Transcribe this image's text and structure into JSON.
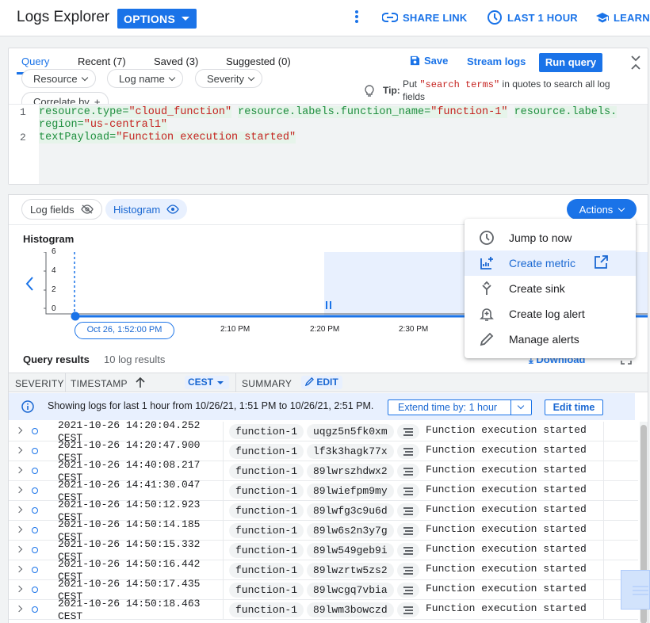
{
  "header": {
    "title": "Logs Explorer",
    "options_label": "OPTIONS",
    "share_label": "SHARE LINK",
    "time_label": "LAST 1 HOUR",
    "learn_label": "LEARN"
  },
  "query": {
    "tabs": [
      {
        "label": "Query"
      },
      {
        "label": "Recent (7)"
      },
      {
        "label": "Saved (3)"
      },
      {
        "label": "Suggested (0)"
      }
    ],
    "save_label": "Save",
    "stream_label": "Stream logs",
    "run_label": "Run query",
    "filters": [
      {
        "label": "Resource"
      },
      {
        "label": "Log name"
      },
      {
        "label": "Severity"
      }
    ],
    "correlate_label": "Correlate by",
    "tip_label": "Tip:",
    "tip_pre": "Put ",
    "tip_code": "\"search terms\"",
    "tip_post": " in quotes to search all log fields",
    "line_numbers": [
      "1",
      "2"
    ],
    "code": {
      "l1_key1": "resource.type",
      "l1_val1": "\"cloud_function\"",
      "l1_key2": "resource.labels.function_name",
      "l1_val2": "\"function-1\"",
      "l1_key3": "resource.labels.",
      "l1b_key3": "region",
      "l1b_val3": "\"us-central1\"",
      "l2_key": "textPayload",
      "l2_val": "\"Function execution started\""
    }
  },
  "results": {
    "log_fields_label": "Log fields",
    "histogram_label": "Histogram",
    "actions_label": "Actions",
    "histogram_title": "Histogram",
    "y_ticks": [
      "6",
      "4",
      "2",
      "0"
    ],
    "x_ticks": [
      "2:10 PM",
      "2:20 PM",
      "2:30 PM"
    ],
    "time_chip": "Oct 26, 1:52:00 PM",
    "query_results_title": "Query results",
    "log_count": "10 log results",
    "download_label": "Download",
    "columns": {
      "severity": "SEVERITY",
      "timestamp": "TIMESTAMP",
      "timezone": "CEST",
      "summary": "SUMMARY",
      "edit": "EDIT"
    },
    "info_text": "Showing logs for last 1 hour from 10/26/21, 1:51 PM to 10/26/21, 2:51 PM.",
    "extend_label": "Extend time by: 1 hour",
    "edit_time_label": "Edit time",
    "rows": [
      {
        "ts": "2021-10-26 14:20:04.252\nCEST",
        "fn": "function-1",
        "id": "uqgz5n5fk0xm",
        "msg": "Function execution started"
      },
      {
        "ts": "2021-10-26 14:20:47.900\nCEST",
        "fn": "function-1",
        "id": "lf3k3hagk77x",
        "msg": "Function execution started"
      },
      {
        "ts": "2021-10-26 14:40:08.217\nCEST",
        "fn": "function-1",
        "id": "89lwrszhdwx2",
        "msg": "Function execution started"
      },
      {
        "ts": "2021-10-26 14:41:30.047\nCEST",
        "fn": "function-1",
        "id": "89lwiefpm9my",
        "msg": "Function execution started"
      },
      {
        "ts": "2021-10-26 14:50:12.923\nCEST",
        "fn": "function-1",
        "id": "89lwfg3c9u6d",
        "msg": "Function execution started"
      },
      {
        "ts": "2021-10-26 14:50:14.185\nCEST",
        "fn": "function-1",
        "id": "89lw6s2n3y7g",
        "msg": "Function execution started"
      },
      {
        "ts": "2021-10-26 14:50:15.332\nCEST",
        "fn": "function-1",
        "id": "89lw549geb9i",
        "msg": "Function execution started"
      },
      {
        "ts": "2021-10-26 14:50:16.442\nCEST",
        "fn": "function-1",
        "id": "89lwzrtw5zs2",
        "msg": "Function execution started"
      },
      {
        "ts": "2021-10-26 14:50:17.435\nCEST",
        "fn": "function-1",
        "id": "89lwcgq7vbia",
        "msg": "Function execution started"
      },
      {
        "ts": "2021-10-26 14:50:18.463\nCEST",
        "fn": "function-1",
        "id": "89lwm3bowczd",
        "msg": "Function execution started"
      }
    ]
  },
  "actions_menu": {
    "items": [
      {
        "label": "Jump to now",
        "icon": "clock-icon"
      },
      {
        "label": "Create metric",
        "icon": "add-chart-icon"
      },
      {
        "label": "Create sink",
        "icon": "merge-icon"
      },
      {
        "label": "Create log alert",
        "icon": "add-alert-icon"
      },
      {
        "label": "Manage alerts",
        "icon": "edit-icon"
      }
    ]
  },
  "colors": {
    "accent": "#1a73e8",
    "accent_light": "#e8f0fe",
    "code_key": "#1e8e3e",
    "code_string": "#c5221f"
  }
}
